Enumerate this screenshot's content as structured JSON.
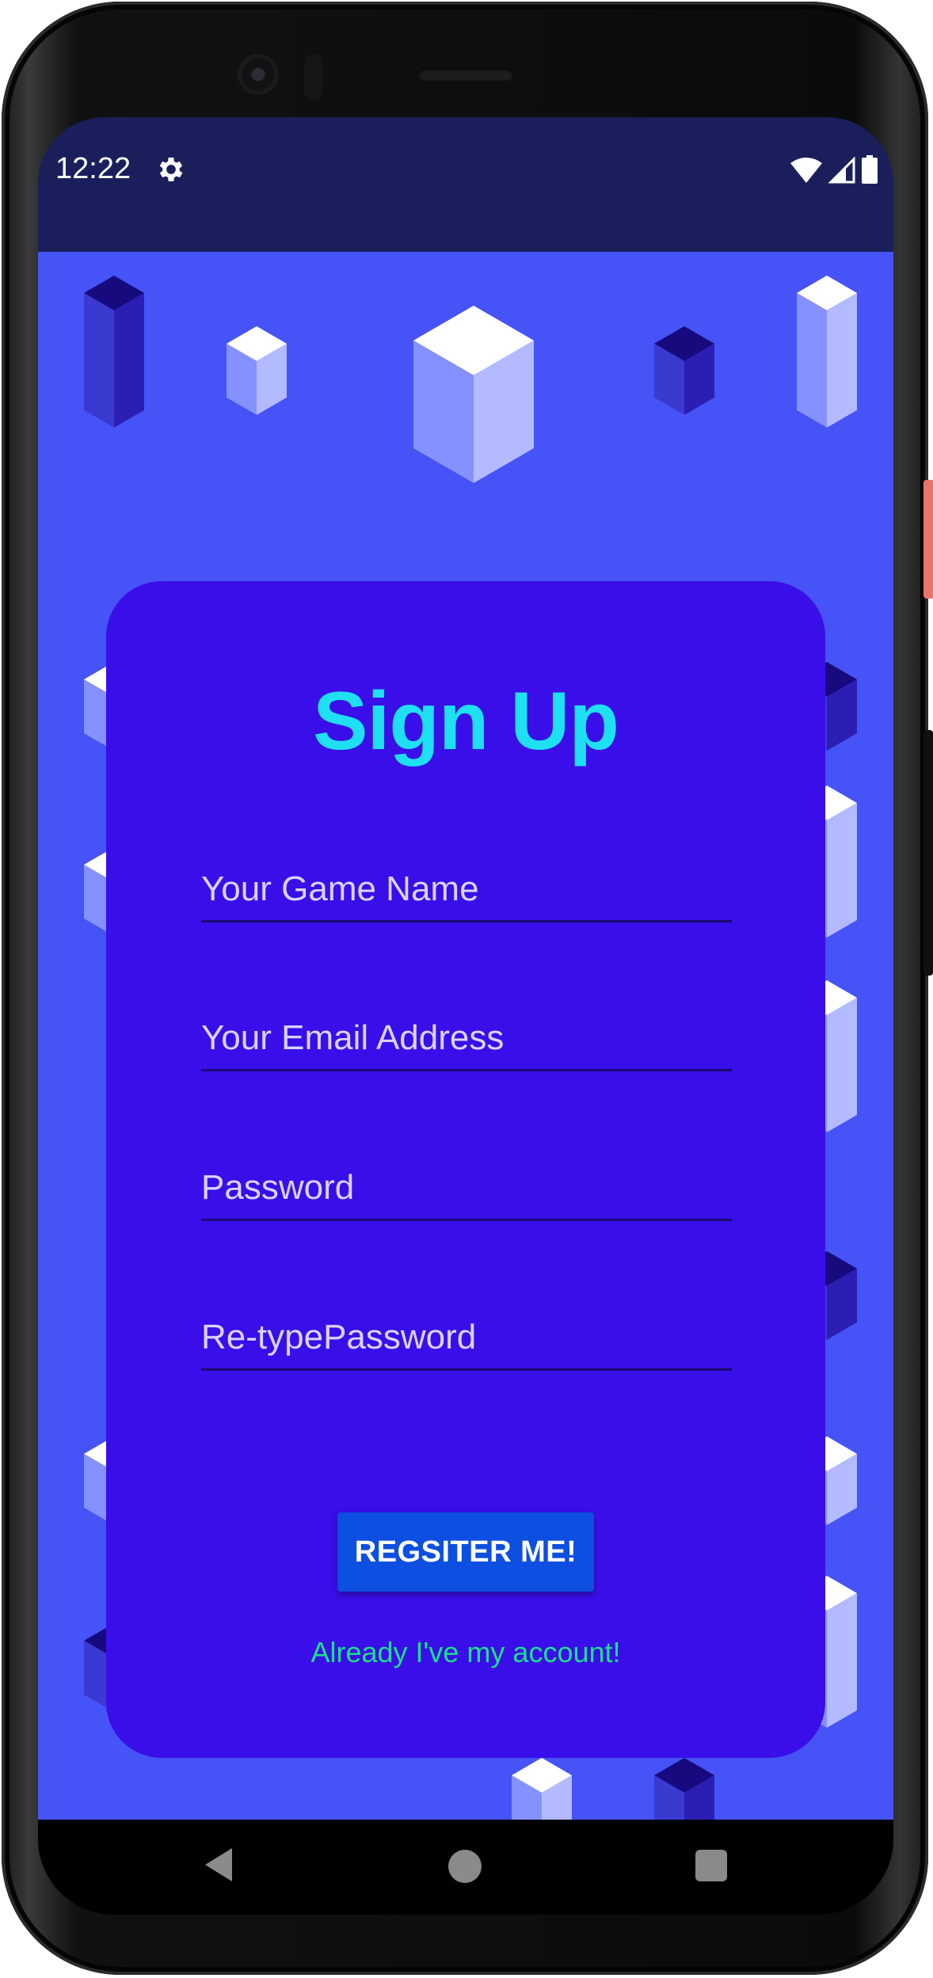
{
  "status_bar": {
    "time": "12:22",
    "icons": [
      "gear-icon",
      "wifi-icon",
      "cell-signal-icon",
      "battery-icon"
    ]
  },
  "signup": {
    "title": "Sign Up",
    "game_name_placeholder": "Your Game Name",
    "email_placeholder": "Your Email Address",
    "password_placeholder": "Password",
    "retype_password_placeholder": "Re-typePassword",
    "register_label": "REGSITER ME!",
    "login_link": "Already I've my account!"
  },
  "nav_bar": {
    "icons": [
      "back-icon",
      "home-icon",
      "recents-icon"
    ]
  },
  "colors": {
    "background": "#4653f6",
    "card": "#3a0ee8",
    "title": "#1ee0f2",
    "button": "#0d4fe0",
    "link": "#19e08a",
    "status_bar": "#1a1f5c"
  }
}
